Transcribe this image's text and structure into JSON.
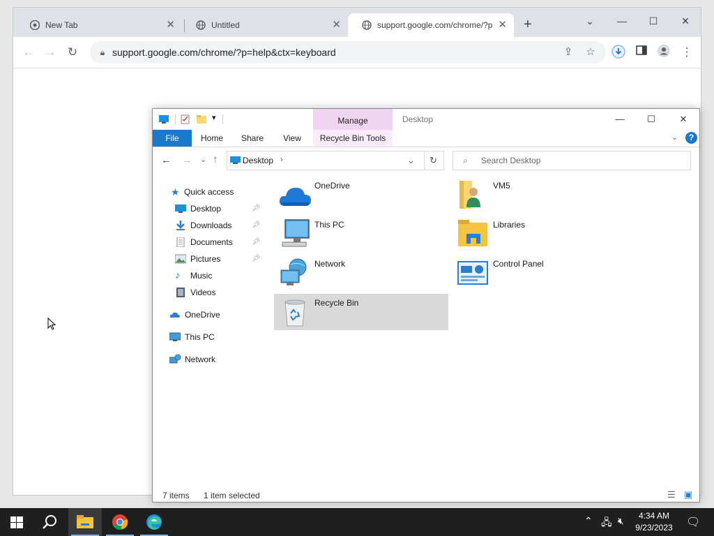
{
  "desktop": {
    "bg_color": "#e7e7e7"
  },
  "chrome": {
    "tabs": [
      {
        "title": "New Tab",
        "icon": "chrome-icon"
      },
      {
        "title": "Untitled",
        "icon": "globe-icon"
      },
      {
        "title": "support.google.com/chrome/?p",
        "icon": "globe-icon",
        "active": true
      }
    ],
    "url": "support.google.com/chrome/?p=help&ctx=keyboard"
  },
  "explorer": {
    "title": "Desktop",
    "contextual_group": "Manage",
    "ribbon_tabs": [
      "File",
      "Home",
      "Share",
      "View",
      "Recycle Bin Tools"
    ],
    "address": "Desktop",
    "search_placeholder": "Search Desktop",
    "nav": {
      "quick_access": "Quick access",
      "pinned": [
        {
          "label": "Desktop",
          "icon": "desktop-icon",
          "pinned": true
        },
        {
          "label": "Downloads",
          "icon": "downloads-icon",
          "pinned": true
        },
        {
          "label": "Documents",
          "icon": "documents-icon",
          "pinned": true
        },
        {
          "label": "Pictures",
          "icon": "pictures-icon",
          "pinned": true
        },
        {
          "label": "Music",
          "icon": "music-icon",
          "pinned": false
        },
        {
          "label": "Videos",
          "icon": "videos-icon",
          "pinned": false
        }
      ],
      "onedrive": "OneDrive",
      "this_pc": "This PC",
      "network": "Network"
    },
    "items": [
      {
        "label": "OneDrive",
        "icon": "onedrive-icon"
      },
      {
        "label": "VM5",
        "icon": "user-folder-icon"
      },
      {
        "label": "This PC",
        "icon": "this-pc-icon"
      },
      {
        "label": "Libraries",
        "icon": "libraries-icon"
      },
      {
        "label": "Network",
        "icon": "network-icon"
      },
      {
        "label": "Control Panel",
        "icon": "control-panel-icon"
      },
      {
        "label": "Recycle Bin",
        "icon": "recycle-bin-icon",
        "selected": true
      }
    ],
    "status": {
      "count": "7 items",
      "selection": "1 item selected"
    }
  },
  "taskbar": {
    "apps": [
      "start-icon",
      "search-icon",
      "file-explorer-icon",
      "chrome-icon",
      "edge-icon"
    ],
    "time": "4:34 AM",
    "date": "9/23/2023"
  }
}
